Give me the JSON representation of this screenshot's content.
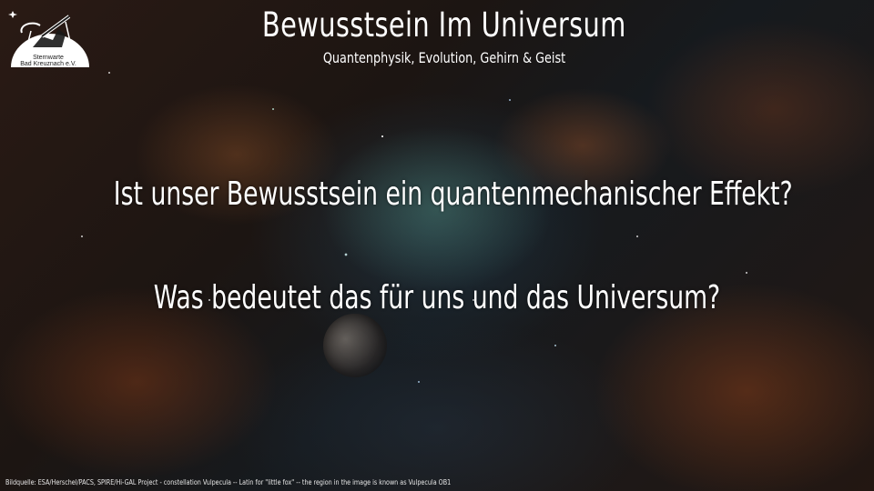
{
  "logo": {
    "line1": "Sternwarte",
    "line2": "Bad Kreuznach e.V."
  },
  "header": {
    "title": "Bewusstsein Im Universum",
    "subtitle": "Quantenphysik,  Evolution,  Gehirn & Geist"
  },
  "body": {
    "question1": "Ist unser Bewusstsein ein quantenmechanischer Effekt?",
    "question2": "Was  bedeutet das für uns und das Universum?"
  },
  "footer": {
    "credit": "Bildquelle: ESA/Herschel/PACS, SPIRE/Hi-GAL Project - constellation Vulpecula -- Latin for \"little fox\" -- the region in the image is known as Vulpecula OB1"
  }
}
